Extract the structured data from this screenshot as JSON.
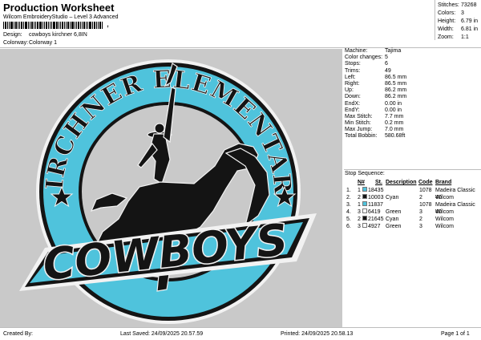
{
  "header": {
    "title": "Production Worksheet",
    "subtitle": "Wilcom EmbroideryStudio – Level 3 Advanced",
    "barcode_tick": ",",
    "design_label": "Design:",
    "design_value": "cowboys kirchner 6,8IN",
    "colorway_label": "Colorway:",
    "colorway_value": "Colorway 1"
  },
  "stats": [
    {
      "label": "Stitches:",
      "value": "73268"
    },
    {
      "label": "Colors:",
      "value": "3"
    },
    {
      "label": "Height:",
      "value": "6.79 in"
    },
    {
      "label": "Width:",
      "value": "6.81 in"
    },
    {
      "label": "Zoom:",
      "value": "1:1"
    }
  ],
  "design": {
    "arc_text": "KIRCHNER ELEMENTARY",
    "banner_text": "COWBOYS",
    "colors": {
      "background": "#c9c9c9",
      "turquoise": "#4fc3dc",
      "black": "#141414",
      "white": "#f2f2f2"
    }
  },
  "machine_info": [
    {
      "label": "Machine:",
      "value": "Tajima"
    },
    {
      "label": "Color changes:",
      "value": "5"
    },
    {
      "label": "Stops:",
      "value": "6"
    },
    {
      "label": "Trims:",
      "value": "49"
    },
    {
      "label": "Left:",
      "value": "86.5 mm"
    },
    {
      "label": "Right:",
      "value": "86.5 mm"
    },
    {
      "label": "Up:",
      "value": "86.2 mm"
    },
    {
      "label": "Down:",
      "value": "86.2 mm"
    },
    {
      "label": "EndX:",
      "value": "0.00 in"
    },
    {
      "label": "EndY:",
      "value": "0.00 in"
    },
    {
      "label": "Max Stitch:",
      "value": "7.7 mm"
    },
    {
      "label": "Min Stitch:",
      "value": "0.2 mm"
    },
    {
      "label": "Max Jump:",
      "value": "7.0 mm"
    },
    {
      "label": "Total Bobbin:",
      "value": "580.68ft"
    }
  ],
  "stop_sequence": {
    "title": "Stop Sequence:",
    "headers": {
      "n": "N#",
      "st": "St.",
      "description": "Description",
      "code": "Code",
      "brand": "Brand"
    },
    "rows": [
      {
        "stop": "1.",
        "seq": "1",
        "color": "#4fc3dc",
        "st": "18435",
        "description": "",
        "code": "1078",
        "brand": "Madeira Classic 40"
      },
      {
        "stop": "2.",
        "seq": "2",
        "color": "#141414",
        "st": "10003",
        "description": "Cyan",
        "code": "2",
        "brand": "Wilcom"
      },
      {
        "stop": "3.",
        "seq": "1",
        "color": "#4fc3dc",
        "st": "11837",
        "description": "",
        "code": "1078",
        "brand": "Madeira Classic 40"
      },
      {
        "stop": "4.",
        "seq": "3",
        "color": "#ffffff",
        "st": "6419",
        "description": "Green",
        "code": "3",
        "brand": "Wilcom"
      },
      {
        "stop": "5.",
        "seq": "2",
        "color": "#141414",
        "st": "21645",
        "description": "Cyan",
        "code": "2",
        "brand": "Wilcom"
      },
      {
        "stop": "6.",
        "seq": "3",
        "color": "#ffffff",
        "st": "4927",
        "description": "Green",
        "code": "3",
        "brand": "Wilcom"
      }
    ]
  },
  "footer": {
    "created_by": "Created By:",
    "last_saved": "Last Saved: 24/09/2025 20.57.59",
    "printed": "Printed: 24/09/2025 20.58.13",
    "page": "Page 1 of 1"
  }
}
